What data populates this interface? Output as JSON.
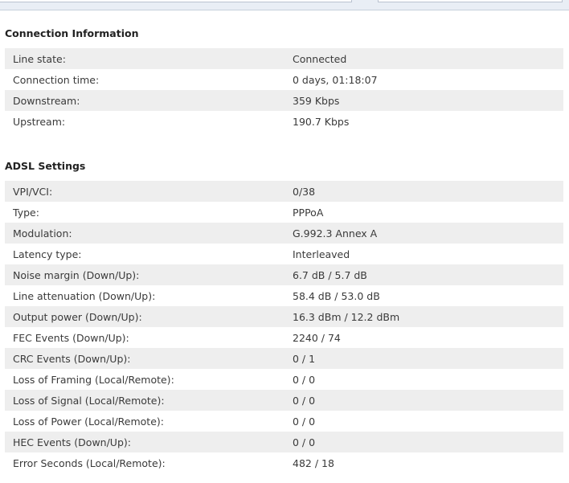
{
  "connection_info": {
    "title": "Connection Information",
    "rows": [
      {
        "label": "Line state:",
        "value": "Connected"
      },
      {
        "label": "Connection time:",
        "value": "0 days, 01:18:07"
      },
      {
        "label": "Downstream:",
        "value": "359 Kbps"
      },
      {
        "label": "Upstream:",
        "value": "190.7 Kbps"
      }
    ]
  },
  "adsl_settings": {
    "title": "ADSL Settings",
    "rows": [
      {
        "label": "VPI/VCI:",
        "value": "0/38"
      },
      {
        "label": "Type:",
        "value": "PPPoA"
      },
      {
        "label": "Modulation:",
        "value": "G.992.3 Annex A"
      },
      {
        "label": "Latency type:",
        "value": "Interleaved"
      },
      {
        "label": "Noise margin (Down/Up):",
        "value": "6.7 dB / 5.7 dB"
      },
      {
        "label": "Line attenuation (Down/Up):",
        "value": "58.4 dB / 53.0 dB"
      },
      {
        "label": "Output power (Down/Up):",
        "value": "16.3 dBm / 12.2 dBm"
      },
      {
        "label": "FEC Events (Down/Up):",
        "value": "2240 / 74"
      },
      {
        "label": "CRC Events (Down/Up):",
        "value": "0 / 1"
      },
      {
        "label": "Loss of Framing (Local/Remote):",
        "value": "0 / 0"
      },
      {
        "label": "Loss of Signal (Local/Remote):",
        "value": "0 / 0"
      },
      {
        "label": "Loss of Power (Local/Remote):",
        "value": "0 / 0"
      },
      {
        "label": "HEC Events (Down/Up):",
        "value": "0 / 0"
      },
      {
        "label": "Error Seconds (Local/Remote):",
        "value": "482 / 18"
      }
    ]
  }
}
